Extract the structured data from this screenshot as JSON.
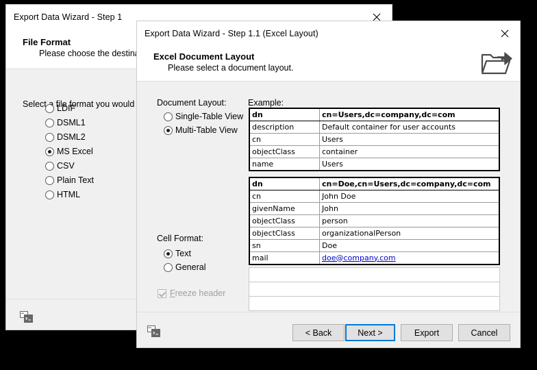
{
  "left_dialog": {
    "title": "Export Data Wizard - Step 1",
    "close_icon": "close-icon",
    "header": {
      "title": "File Format",
      "subtitle": "Please choose the destination"
    },
    "instruction": "Select a file format you would like t",
    "formats": [
      {
        "label": "LDIF",
        "selected": false
      },
      {
        "label": "DSML1",
        "selected": false
      },
      {
        "label": "DSML2",
        "selected": false
      },
      {
        "label": "MS Excel",
        "selected": true
      },
      {
        "label": "CSV",
        "selected": false
      },
      {
        "label": "Plain Text",
        "selected": false
      },
      {
        "label": "HTML",
        "selected": false
      }
    ],
    "footer_icon": "window-terminal-icon"
  },
  "right_dialog": {
    "title": "Export Data Wizard - Step 1.1 (Excel Layout)",
    "close_icon": "close-icon",
    "header": {
      "title": "Excel Document Layout",
      "subtitle": "Please select a document layout.",
      "icon": "export-folder-icon"
    },
    "document_layout": {
      "label": "Document Layout:",
      "options": [
        {
          "label": "Single-Table View",
          "selected": false
        },
        {
          "label": "Multi-Table View",
          "selected": true
        }
      ]
    },
    "cell_format": {
      "label": "Cell Format:",
      "options": [
        {
          "label": "Text",
          "selected": true
        },
        {
          "label": "General",
          "selected": false
        }
      ]
    },
    "freeze_header": {
      "label_prefix": "F",
      "label_rest": "reeze header",
      "checked": true,
      "disabled": true
    },
    "example": {
      "label": "Example:",
      "table1": [
        {
          "key": "dn",
          "value": "cn=Users,dc=company,dc=com",
          "header": true
        },
        {
          "key": "description",
          "value": "Default container for user accounts",
          "header": false
        },
        {
          "key": "cn",
          "value": "Users",
          "header": false
        },
        {
          "key": "objectClass",
          "value": "container",
          "header": false
        },
        {
          "key": "name",
          "value": "Users",
          "header": false
        }
      ],
      "table2": [
        {
          "key": "dn",
          "value": "cn=Doe,cn=Users,dc=company,dc=com",
          "header": true,
          "link": false
        },
        {
          "key": "cn",
          "value": "John Doe",
          "header": false,
          "link": false
        },
        {
          "key": "givenName",
          "value": "John",
          "header": false,
          "link": false
        },
        {
          "key": "objectClass",
          "value": "person",
          "header": false,
          "link": false
        },
        {
          "key": "objectClass",
          "value": "organizationalPerson",
          "header": false,
          "link": false
        },
        {
          "key": "sn",
          "value": "Doe",
          "header": false,
          "link": false
        },
        {
          "key": "mail",
          "value": "doe@company.com",
          "header": false,
          "link": true
        }
      ],
      "blank_rows": 3
    },
    "footer_icon": "window-terminal-icon",
    "buttons": [
      {
        "label": "< Back",
        "focused": false
      },
      {
        "label": "Next >",
        "focused": true
      },
      {
        "label": "Export",
        "focused": false
      },
      {
        "label": "Cancel",
        "focused": false
      }
    ]
  },
  "colors": {
    "dialog_bg": "#f0f0f0",
    "titlebar_bg": "#ffffff",
    "focus_border": "#0078d7",
    "link": "#0000cc",
    "desktop": "#000000"
  }
}
